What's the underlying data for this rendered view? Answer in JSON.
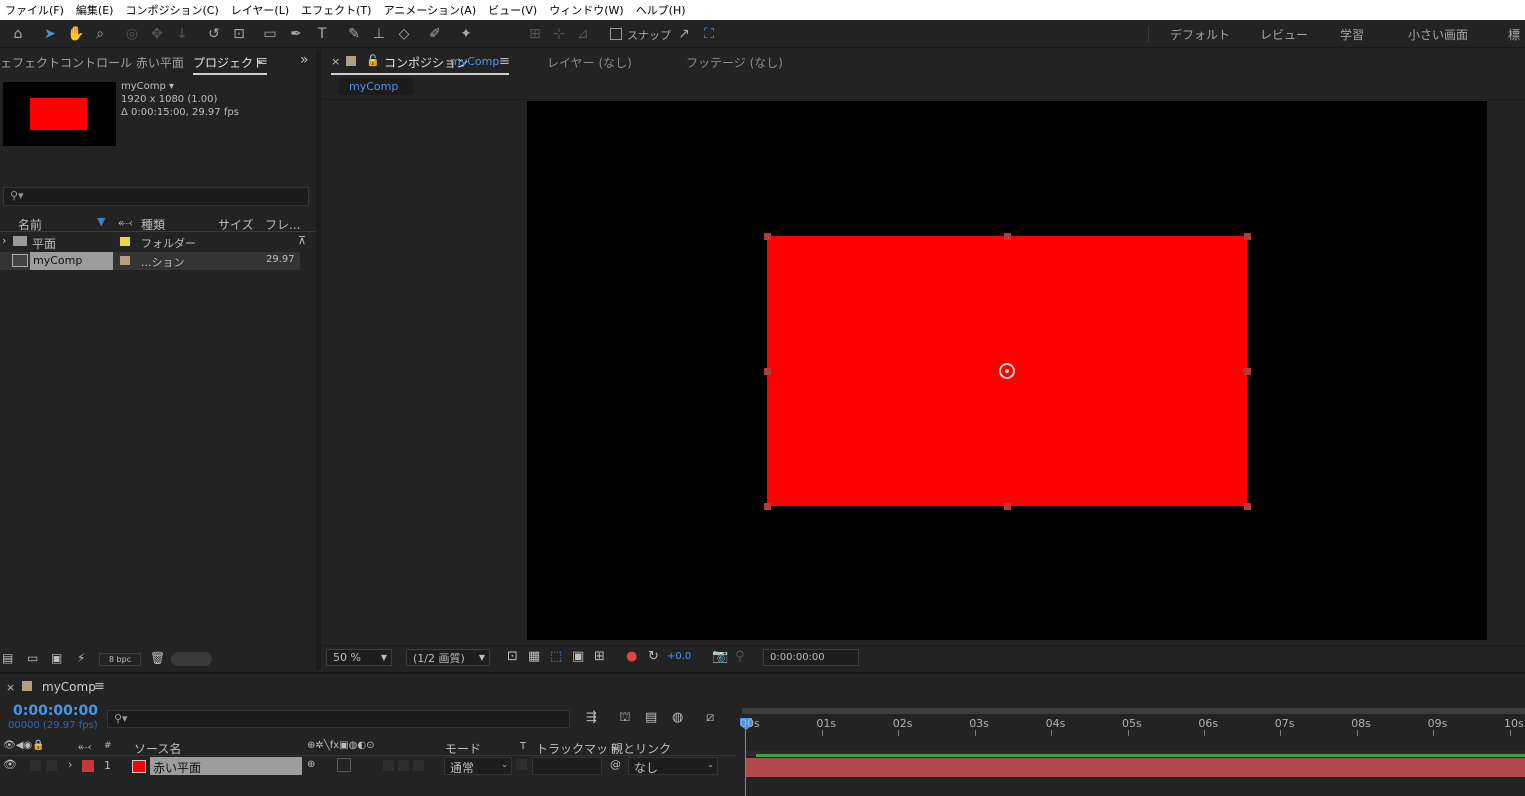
{
  "menu": [
    "ファイル(F)",
    "編集(E)",
    "コンポジション(C)",
    "レイヤー(L)",
    "エフェクト(T)",
    "アニメーション(A)",
    "ビュー(V)",
    "ウィンドウ(W)",
    "ヘルプ(H)"
  ],
  "toolbar": {
    "snap_label": "スナップ",
    "workspaces": [
      "デフォルト",
      "レビュー",
      "学習",
      "小さい画面",
      "標"
    ]
  },
  "project_panel": {
    "effect_tab": "ェフェクトコントロール 赤い平面",
    "project_tab": "プロジェクト",
    "comp_name": "myComp ▾",
    "comp_size": "1920 x 1080 (1.00)",
    "comp_duration": "Δ 0:00:15:00, 29.97 fps",
    "search_placeholder": "",
    "columns": {
      "name": "名前",
      "type": "種類",
      "size": "サイズ",
      "fr": "フレ..."
    },
    "rows": [
      {
        "name": "平面",
        "type": "フォルダー",
        "fps": ""
      },
      {
        "name": "myComp",
        "type": "...ション",
        "fps": "29.97"
      }
    ],
    "bpc": "8 bpc"
  },
  "viewer": {
    "comp_tab_label": "コンポジション",
    "comp_tab_name": "myComp",
    "layer_tab": "レイヤー (なし)",
    "footage_tab": "フッテージ (なし)",
    "breadcrumb": "myComp",
    "zoom": "50 %",
    "resolution": "(1/2 画質)",
    "exposure": "+0.0",
    "timecode": "0:00:00:00",
    "solid_color": "#ff0000"
  },
  "timeline": {
    "tab_name": "myComp",
    "timecode": "0:00:00:00",
    "frames": "00000 (29.97 fps)",
    "columns": {
      "hash": "#",
      "source": "ソース名",
      "mode": "モード",
      "trkmat_t": "T",
      "trackmatte": "トラックマット",
      "parent": "親とリンク"
    },
    "layer": {
      "index": "1",
      "name": "赤い平面",
      "mode": "通常",
      "parent": "なし",
      "label_color": "#c43a3a"
    },
    "ruler": [
      "00s",
      "01s",
      "02s",
      "03s",
      "04s",
      "05s",
      "06s",
      "07s",
      "08s",
      "09s",
      "10s"
    ]
  }
}
